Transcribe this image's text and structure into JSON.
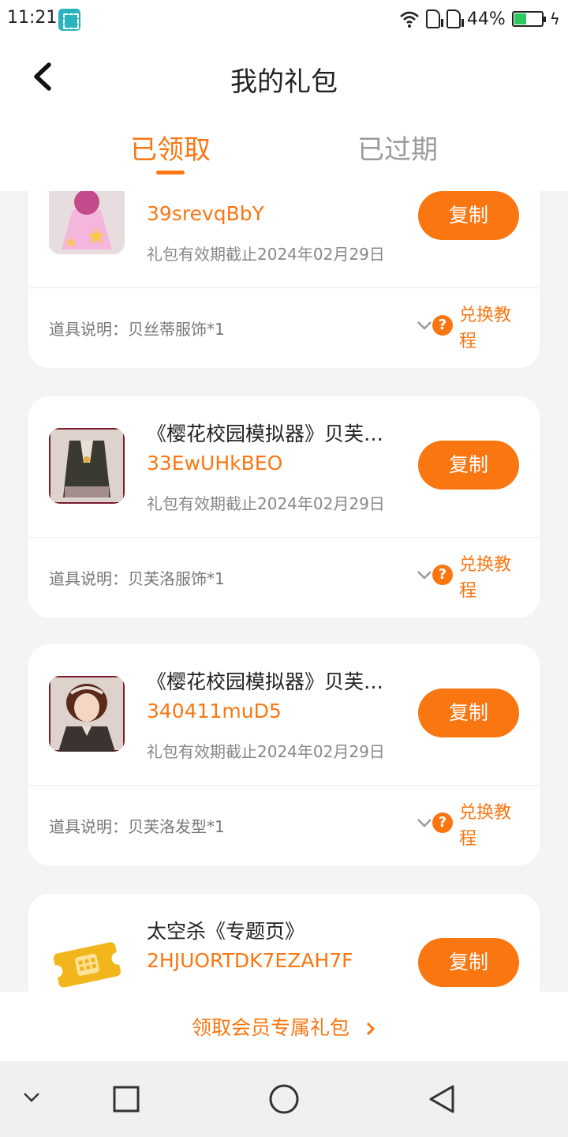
{
  "status_bar": {
    "time": "11:21",
    "battery_percent": "44%",
    "battery_level": 0.44,
    "icons": [
      "screenshot-scan-icon",
      "wifi-icon",
      "sim-signal-icon",
      "battery-icon",
      "charging-icon"
    ]
  },
  "header": {
    "title": "我的礼包",
    "tabs": [
      {
        "label": "已领取",
        "active": true
      },
      {
        "label": "已过期",
        "active": false
      }
    ]
  },
  "cards": [
    {
      "game_name": "",
      "code": "39srevqBbY",
      "expiry": "礼包有效期截止2024年02月29日",
      "copy_label": "复制",
      "item_desc": "道具说明：贝丝蒂服饰*1",
      "tutorial_label": "兑换教程"
    },
    {
      "game_name": "《樱花校园模拟器》贝芙…",
      "code": "33EwUHkBEO",
      "expiry": "礼包有效期截止2024年02月29日",
      "copy_label": "复制",
      "item_desc": "道具说明：贝芙洛服饰*1",
      "tutorial_label": "兑换教程"
    },
    {
      "game_name": "《樱花校园模拟器》贝芙…",
      "code": "340411muD5",
      "expiry": "礼包有效期截止2024年02月29日",
      "copy_label": "复制",
      "item_desc": "道具说明：贝芙洛发型*1",
      "tutorial_label": "兑换教程"
    },
    {
      "game_name": "太空杀《专题页》",
      "code": "2HJUORTDK7EZAH7F",
      "expiry": "",
      "copy_label": "复制",
      "item_desc": "",
      "tutorial_label": ""
    }
  ],
  "member_link": {
    "label": "领取会员专属礼包"
  },
  "colors": {
    "accent": "#fa7611",
    "background": "#f4f4f4",
    "card": "#ffffff"
  }
}
